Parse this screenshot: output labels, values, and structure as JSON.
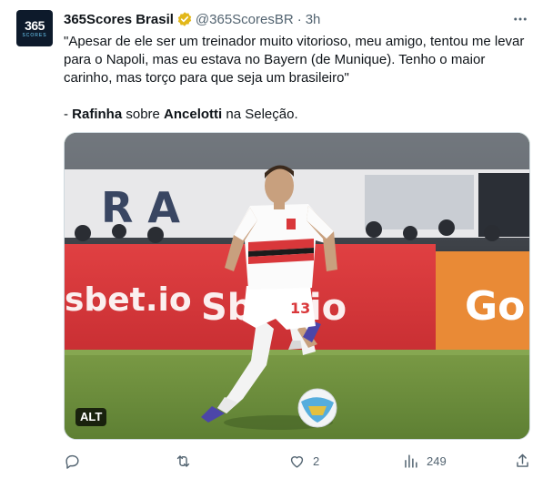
{
  "tweet": {
    "display_name": "365Scores Brasil",
    "verified_icon": "verified-badge-icon",
    "handle": "@365ScoresBR",
    "separator": "·",
    "time": "3h",
    "avatar": {
      "logo_text": "365",
      "logo_sub": "SCORES"
    },
    "text": {
      "quote": "\"Apesar de ele ser um treinador muito vitorioso, meu amigo, tentou me levar para o Napoli, mas eu estava no Bayern (de Munique). Tenho o maior carinho, mas torço para que seja um brasileiro\"",
      "dash": "- ",
      "name1": "Rafinha",
      "mid": " sobre ",
      "name2": "Ancelotti",
      "end": " na Seleção."
    },
    "media": {
      "alt_label": "ALT",
      "banner_text_left": "sbet.io",
      "banner_text_right": "Sbet.io",
      "banner_far_right": "Go",
      "shirt_number": "13"
    }
  },
  "actions": {
    "reply_count": "",
    "retweet_count": "",
    "like_count": "2",
    "views_count": "249"
  },
  "colors": {
    "text": "#0f1419",
    "secondary": "#536471",
    "verified": "#e2b719",
    "banner_red": "#d9373a",
    "pitch": "#6b8a3c"
  }
}
